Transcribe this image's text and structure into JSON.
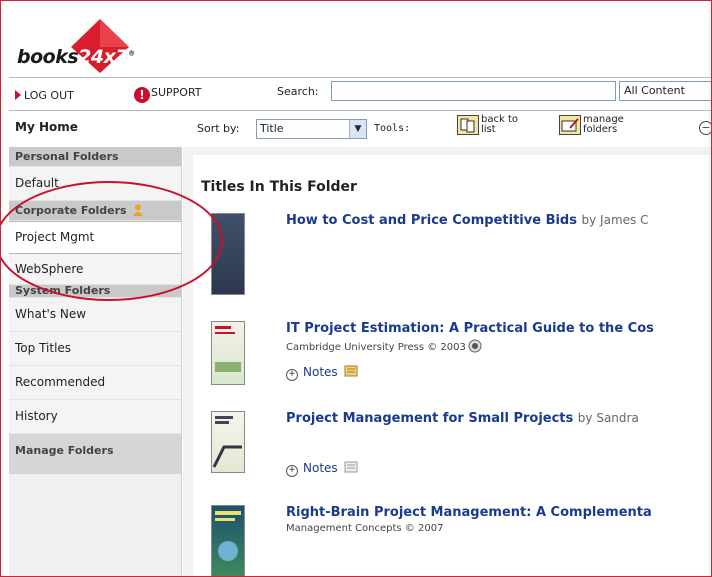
{
  "brand": {
    "logo_text": "books",
    "logo_badge": "24x7",
    "registered": "®"
  },
  "topbar": {
    "logout_label": "LOG OUT",
    "support_label": "SUPPORT",
    "search_label": "Search:",
    "search_value": "",
    "scope_selected": "All Content"
  },
  "toolbar": {
    "home_label": "My Home",
    "sortby_label": "Sort by:",
    "sort_selected": "Title",
    "tools_label": "Tools:",
    "back_label_1": "back to",
    "back_label_2": "list",
    "manage_label_1": "manage",
    "manage_label_2": "folders"
  },
  "sidebar": {
    "personal_header": "Personal Folders",
    "personal_items": [
      "Default"
    ],
    "corporate_header": "Corporate Folders",
    "corporate_items": [
      "Project Mgmt",
      "WebSphere"
    ],
    "system_header": "System Folders",
    "system_items": [
      "What's New",
      "Top Titles",
      "Recommended",
      "History"
    ],
    "manage_label": "Manage Folders"
  },
  "main": {
    "heading": "Titles In This Folder",
    "books": [
      {
        "title": "How to Cost and Price Competitive Bids",
        "byline": "by James C",
        "publisher": "",
        "notes": ""
      },
      {
        "title": "IT Project Estimation: A Practical Guide to the Cos",
        "byline": "",
        "publisher": "Cambridge University Press © 2003",
        "notes": "Notes"
      },
      {
        "title": "Project Management for Small Projects",
        "byline": "by Sandra",
        "publisher": "",
        "notes": "Notes"
      },
      {
        "title": "Right-Brain Project Management: A Complementa",
        "byline": "",
        "publisher": "Management Concepts © 2007",
        "notes": ""
      }
    ]
  },
  "colors": {
    "brand_red": "#c8102e",
    "link_blue": "#1a3a8c",
    "highlight_oval": "#c8102e"
  }
}
